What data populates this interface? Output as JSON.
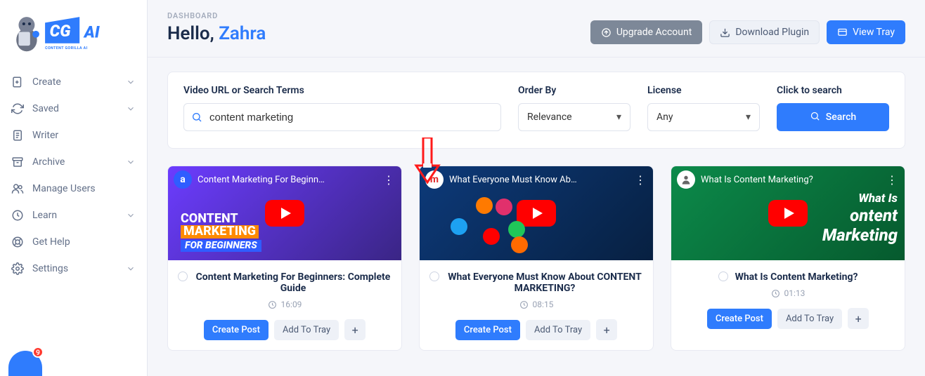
{
  "sidebar": {
    "items": [
      {
        "icon": "plus-doc-icon",
        "label": "Create",
        "expandable": true
      },
      {
        "icon": "refresh-icon",
        "label": "Saved",
        "expandable": true
      },
      {
        "icon": "doc-icon",
        "label": "Writer",
        "expandable": false
      },
      {
        "icon": "archive-icon",
        "label": "Archive",
        "expandable": true
      },
      {
        "icon": "users-icon",
        "label": "Manage Users",
        "expandable": false
      },
      {
        "icon": "clock-icon",
        "label": "Learn",
        "expandable": true
      },
      {
        "icon": "life-ring-icon",
        "label": "Get Help",
        "expandable": false
      },
      {
        "icon": "gear-icon",
        "label": "Settings",
        "expandable": true
      }
    ],
    "chat_badge": "9"
  },
  "header": {
    "breadcrumb": "DASHBOARD",
    "greeting_prefix": "Hello, ",
    "greeting_name": "Zahra",
    "upgrade_label": "Upgrade Account",
    "download_label": "Download Plugin",
    "view_tray_label": "View Tray"
  },
  "search": {
    "url_label": "Video URL or Search Terms",
    "url_value": "content marketing",
    "order_label": "Order By",
    "order_value": "Relevance",
    "license_label": "License",
    "license_value": "Any",
    "click_label": "Click to search",
    "search_button": "Search"
  },
  "cards": [
    {
      "yt_title": "Content Marketing For Beginn…",
      "channel_letter": "a",
      "thumb_line1": "CONTENT",
      "thumb_line2": "MARKETING",
      "thumb_line3": "FOR BEGINNERS",
      "title": "Content Marketing For Beginners: Complete Guide",
      "duration": "16:09",
      "create_label": "Create Post",
      "tray_label": "Add To Tray"
    },
    {
      "yt_title": "What Everyone Must Know Ab…",
      "channel_letter": "m",
      "title": "What Everyone Must Know About CONTENT MARKETING?",
      "duration": "08:15",
      "create_label": "Create Post",
      "tray_label": "Add To Tray"
    },
    {
      "yt_title": "What Is Content Marketing?",
      "channel_letter": "",
      "thumb_overlay1": "What Is",
      "thumb_overlay2": "ontent",
      "thumb_overlay3": "Marketing",
      "title": "What Is Content Marketing?",
      "duration": "01:13",
      "create_label": "Create Post",
      "tray_label": "Add To Tray"
    }
  ]
}
